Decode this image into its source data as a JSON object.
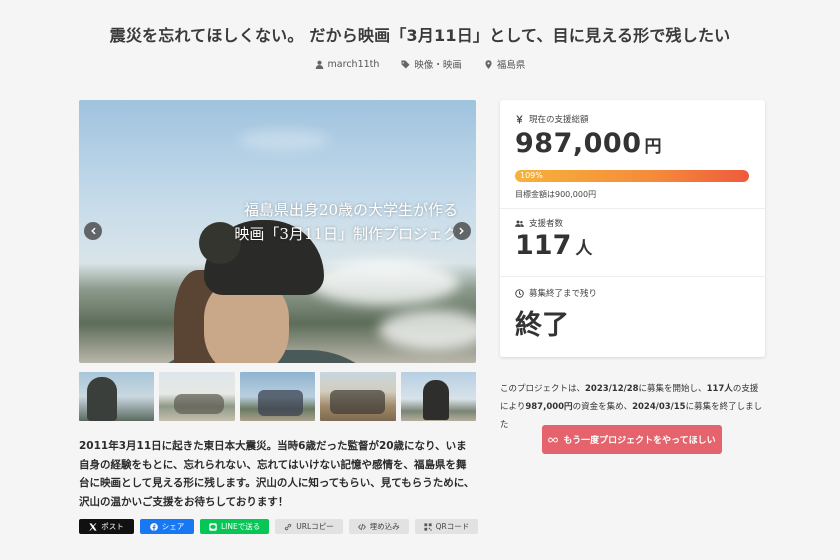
{
  "page": {
    "title": "震災を忘れてほしくない。 だから映画「3月11日」として、目に見える形で残したい"
  },
  "meta": {
    "author": "march11th",
    "category": "映像・映画",
    "location": "福島県",
    "icons": [
      "user-icon",
      "tag-icon",
      "location-pin-icon"
    ]
  },
  "hero": {
    "caption_line1": "福島県出身20歳の大学生が作る",
    "caption_line2": "映画「3月11日」制作プロジェク"
  },
  "gallery": {
    "thumbnails": [
      "thumbnail-1",
      "thumbnail-2",
      "thumbnail-3",
      "thumbnail-4",
      "thumbnail-5"
    ]
  },
  "description": "2011年3月11日に起きた東日本大震災。当時6歳だった監督が20歳になり、いま自身の経験をもとに、忘れられない、忘れてはいけない記憶や感情を、福島県を舞台に映画として見える形に残します。沢山の人に知ってもらい、見てもらうために、沢山の温かいご支援をお待ちしております！",
  "share": {
    "x_label": "ポスト",
    "facebook_label": "シェア",
    "line_label": "LINEで送る",
    "url_copy_label": "URLコピー",
    "embed_label": "埋め込み",
    "qr_label": "QRコード"
  },
  "stats": {
    "total_label": "現在の支援総額",
    "total_amount": "987,000",
    "total_unit": "円",
    "progress_percent": 109,
    "progress_text": "109%",
    "goal_text": "目標金額は900,000円",
    "supporters_label": "支援者数",
    "supporters_count": "117",
    "supporters_unit": "人",
    "remaining_label": "募集終了まで残り",
    "remaining_value": "終了"
  },
  "summary": {
    "part1": "このプロジェクトは、",
    "start_date": "2023/12/28",
    "part2": "に募集を開始し、",
    "supporters": "117人",
    "part3": "の支援により",
    "amount": "987,000円",
    "part4": "の資金を集め、",
    "end_date": "2024/03/15",
    "part5": "に募集を終了しました"
  },
  "cta": {
    "label": "もう一度プロジェクトをやってほしい"
  },
  "colors": {
    "cta": "#e5636c",
    "progress_start": "#f6b23b",
    "progress_end": "#ef5a3c",
    "line": "#06c755",
    "facebook": "#1877f2"
  }
}
